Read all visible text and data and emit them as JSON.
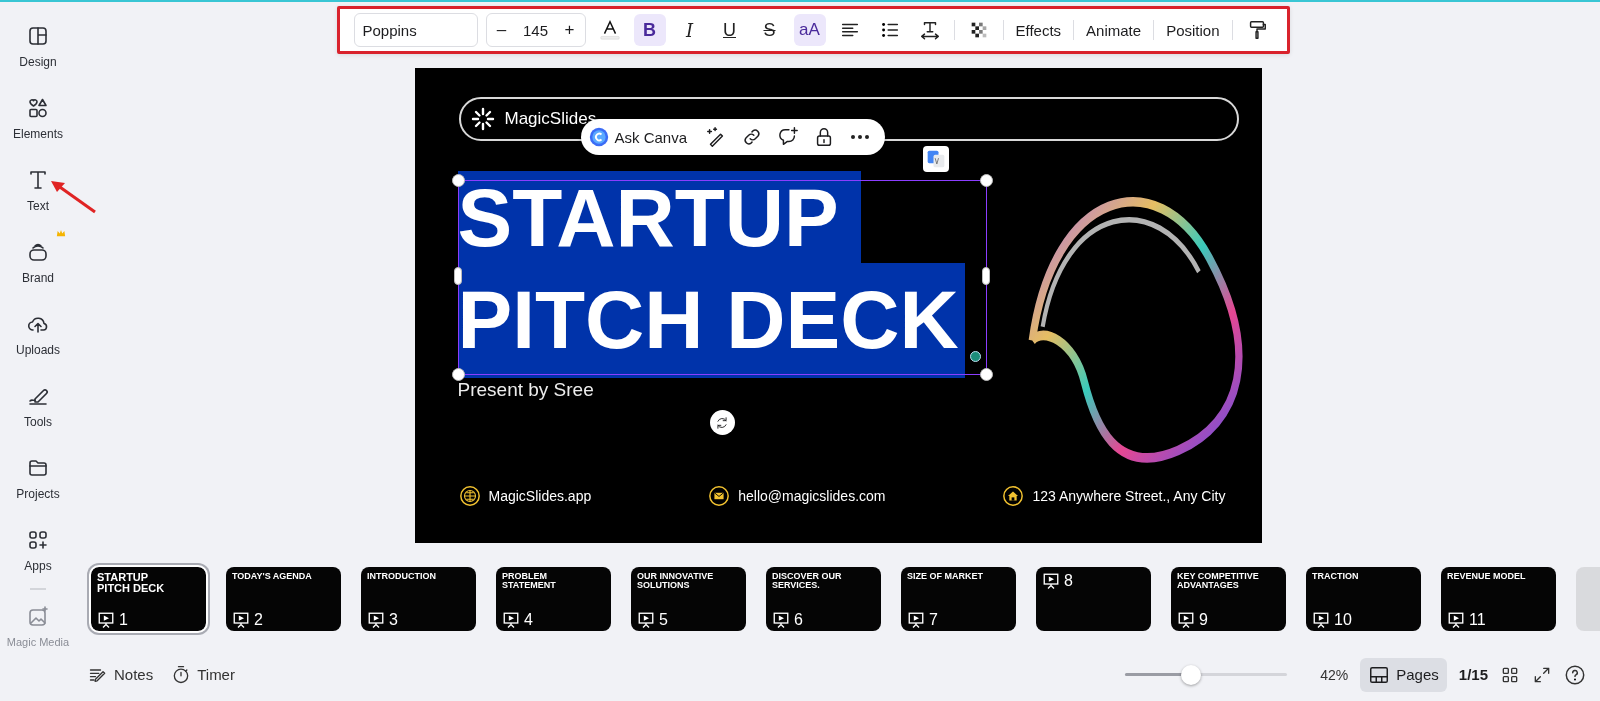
{
  "sidebar": {
    "items": [
      {
        "kind": "design",
        "label": "Design"
      },
      {
        "kind": "elements",
        "label": "Elements"
      },
      {
        "kind": "text",
        "label": "Text"
      },
      {
        "kind": "brand",
        "label": "Brand",
        "crown": true
      },
      {
        "kind": "uploads",
        "label": "Uploads"
      },
      {
        "kind": "tools",
        "label": "Tools"
      },
      {
        "kind": "projects",
        "label": "Projects"
      },
      {
        "kind": "apps",
        "label": "Apps"
      },
      {
        "kind": "magic",
        "label": "Magic Media",
        "disabled": true
      }
    ]
  },
  "toolbar": {
    "font": "Poppins",
    "minus": "–",
    "size": "145",
    "plus": "+",
    "format_buttons": [
      {
        "kind": "color"
      },
      {
        "kind": "bold",
        "label": "B",
        "active": true
      },
      {
        "kind": "italic",
        "label": "I",
        "active": false
      },
      {
        "kind": "underline",
        "label": "U",
        "active": false
      },
      {
        "kind": "strike",
        "label": "S",
        "active": false
      },
      {
        "kind": "case",
        "label": "aA",
        "active": true
      },
      {
        "kind": "align"
      },
      {
        "kind": "list"
      },
      {
        "kind": "spacing"
      },
      {
        "kind": "transparency"
      }
    ],
    "text_buttons": [
      "Effects",
      "Animate",
      "Position"
    ]
  },
  "slide": {
    "logo": "MagicSlides",
    "title_lines": [
      "STARTUP",
      "PITCH DECK"
    ],
    "subtitle": "Present by Sree",
    "footer": [
      {
        "kind": "globe",
        "text": "MagicSlides.app"
      },
      {
        "kind": "mail",
        "text": "hello@magicslides.com"
      },
      {
        "kind": "home",
        "text": "123 Anywhere Street., Any City"
      }
    ]
  },
  "context_toolbar": {
    "ask": "Ask Canva"
  },
  "thumbnails": [
    {
      "title": "STARTUP PITCH DECK",
      "number": "1",
      "selected": true
    },
    {
      "title": "TODAY'S AGENDA",
      "number": "2",
      "selected": false
    },
    {
      "title": "INTRODUCTION",
      "number": "3",
      "selected": false
    },
    {
      "title": "PROBLEM STATEMENT",
      "number": "4",
      "selected": false
    },
    {
      "title": "OUR INNOVATIVE SOLUTIONS",
      "number": "5",
      "selected": false
    },
    {
      "title": "DISCOVER OUR SERVICES.",
      "number": "6",
      "selected": false
    },
    {
      "title": "SIZE OF MARKET",
      "number": "7",
      "selected": false
    },
    {
      "number": "8",
      "selected": false
    },
    {
      "title": "KEY COMPETITIVE ADVANTAGES",
      "number": "9",
      "selected": false
    },
    {
      "title": "TRACTION",
      "number": "10",
      "selected": false
    },
    {
      "title": "REVENUE MODEL",
      "number": "11",
      "selected": false
    },
    {
      "selected": false
    }
  ],
  "bottom_bar": {
    "notes": "Notes",
    "timer": "Timer",
    "zoom": {
      "level": 0.38,
      "reading": "42%"
    },
    "pages": {
      "label": "Pages",
      "selected": true
    },
    "page_count": "1/15"
  }
}
